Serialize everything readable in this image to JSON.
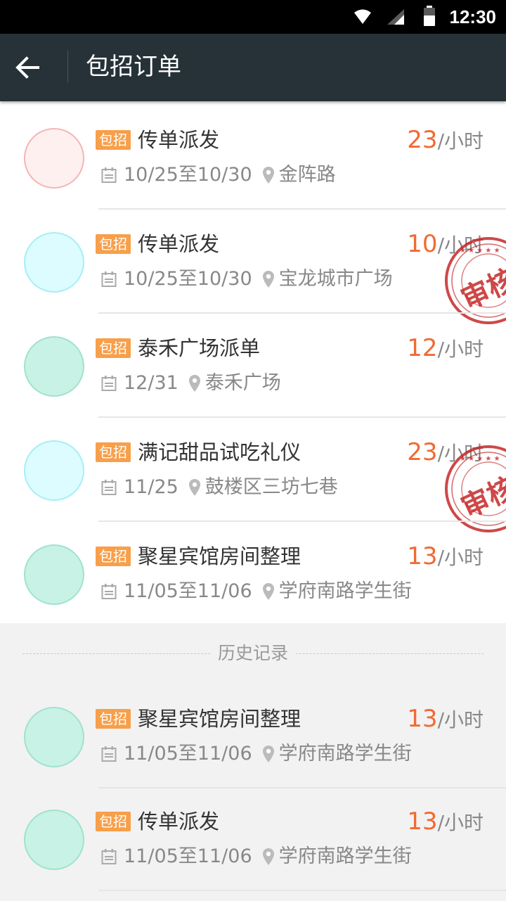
{
  "status_bar": {
    "time": "12:30"
  },
  "toolbar": {
    "title": "包招订单",
    "back_icon": "arrow-left-icon"
  },
  "colors": {
    "accent": "#f26a32",
    "tag_bg": "#f79f4a",
    "toolbar_bg": "#263238",
    "stamp": "#c62828"
  },
  "orders": [
    {
      "tag": "包招",
      "title": "传单派发",
      "rate": "23",
      "unit": "/小时",
      "date": "10/25至10/30",
      "location": "金阵路",
      "avatar_fill": "#fff0f0",
      "avatar_border": "#f5b5b5",
      "stamp": null
    },
    {
      "tag": "包招",
      "title": "传单派发",
      "rate": "10",
      "unit": "/小时",
      "date": "10/25至10/30",
      "location": "宝龙城市广场",
      "avatar_fill": "#dcfcff",
      "avatar_border": "#a7eef5",
      "stamp": "审核中"
    },
    {
      "tag": "包招",
      "title": "泰禾广场派单",
      "rate": "12",
      "unit": "/小时",
      "date": "12/31",
      "location": "泰禾广场",
      "avatar_fill": "#c8f2e5",
      "avatar_border": "#9fe3cd",
      "stamp": null
    },
    {
      "tag": "包招",
      "title": "满记甜品试吃礼仪",
      "rate": "23",
      "unit": "/小时",
      "date": "11/25",
      "location": "鼓楼区三坊七巷",
      "avatar_fill": "#dcfcff",
      "avatar_border": "#a7eef5",
      "stamp": "审核中"
    },
    {
      "tag": "包招",
      "title": "聚星宾馆房间整理",
      "rate": "13",
      "unit": "/小时",
      "date": "11/05至11/06",
      "location": "学府南路学生街",
      "avatar_fill": "#c8f2e5",
      "avatar_border": "#9fe3cd",
      "stamp": null
    }
  ],
  "history": {
    "label": "历史记录",
    "items": [
      {
        "tag": "包招",
        "title": "聚星宾馆房间整理",
        "rate": "13",
        "unit": "/小时",
        "date": "11/05至11/06",
        "location": "学府南路学生街",
        "avatar_fill": "#c8f2e5",
        "avatar_border": "#9fe3cd"
      },
      {
        "tag": "包招",
        "title": "传单派发",
        "rate": "13",
        "unit": "/小时",
        "date": "11/05至11/06",
        "location": "学府南路学生街",
        "avatar_fill": "#c8f2e5",
        "avatar_border": "#9fe3cd"
      }
    ]
  }
}
